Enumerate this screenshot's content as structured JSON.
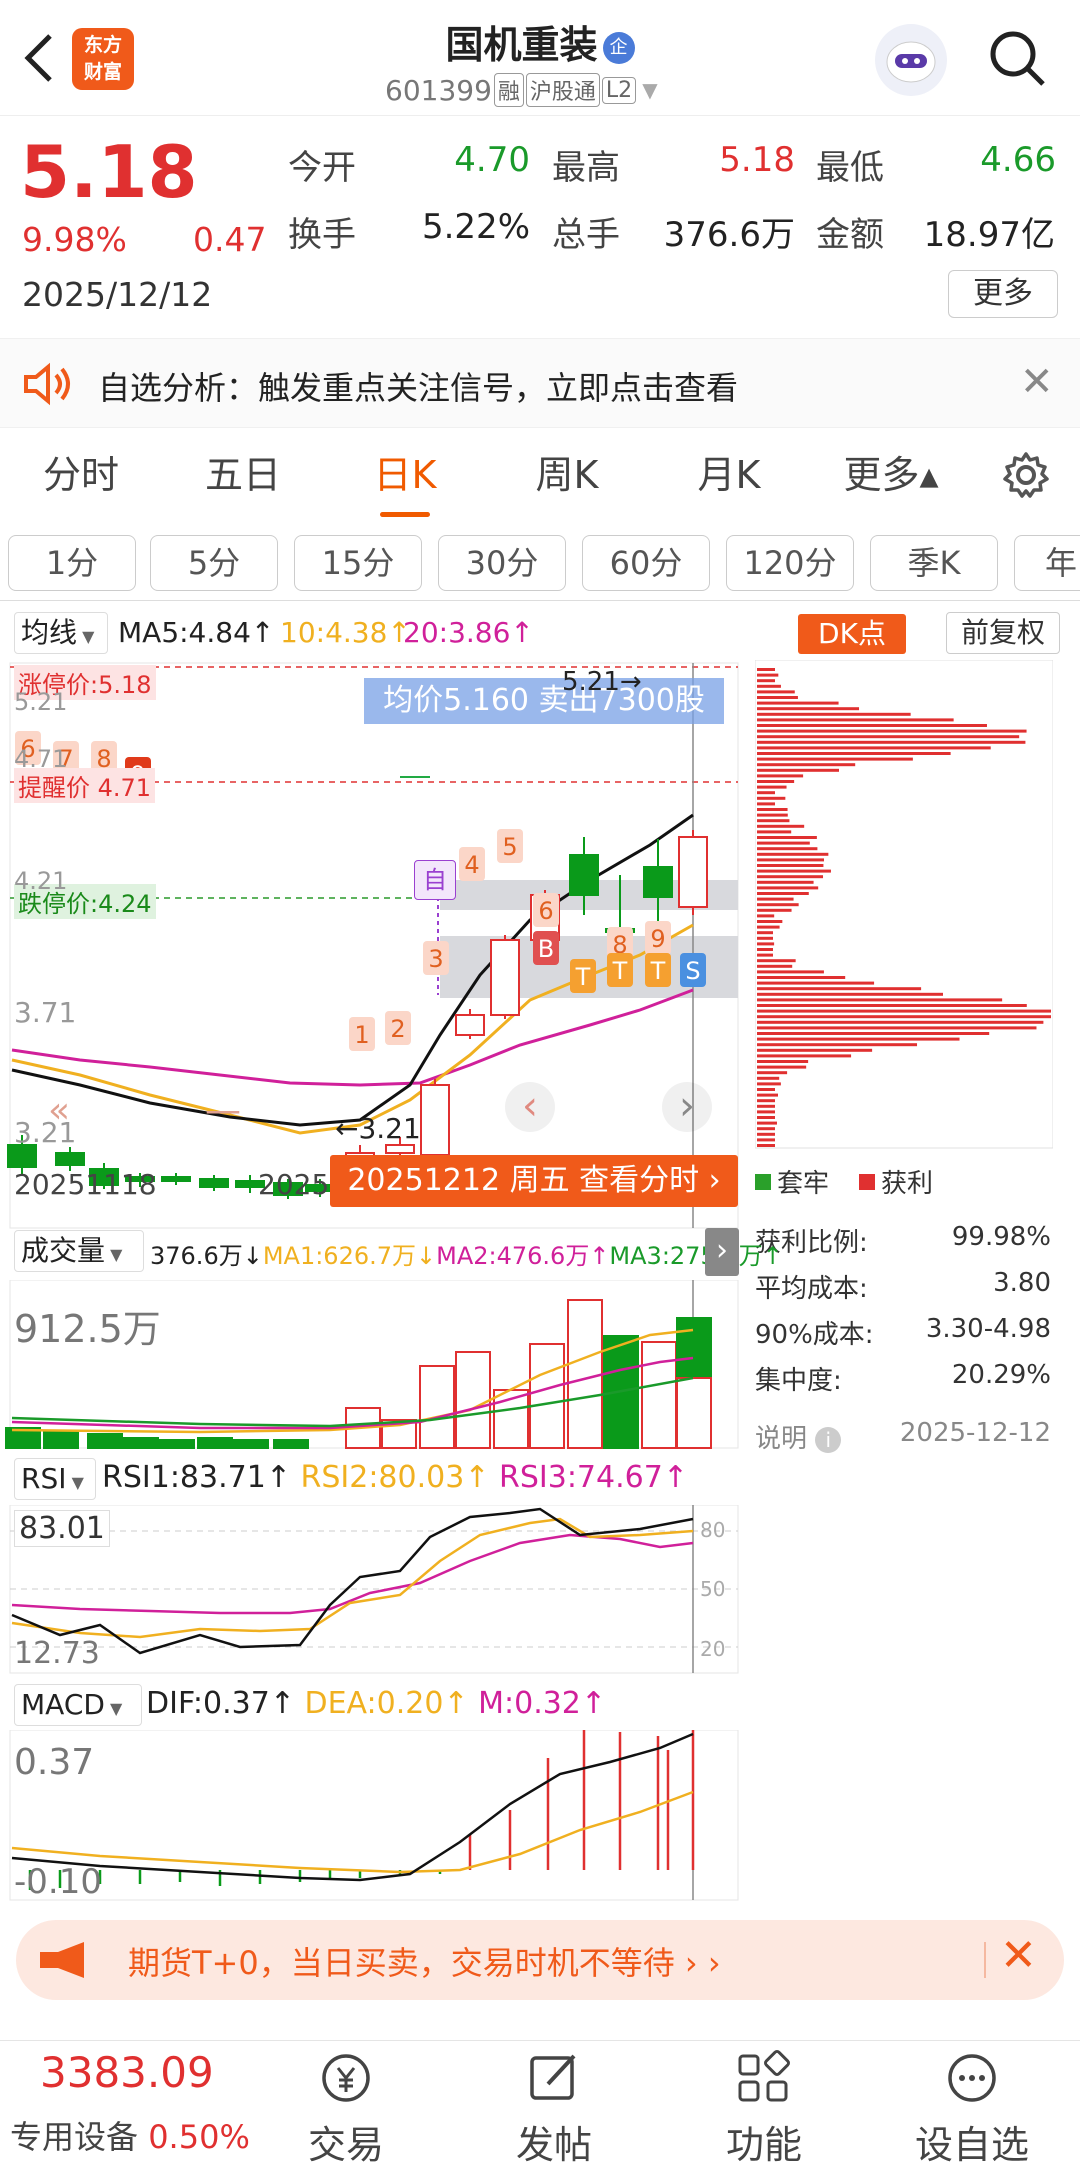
{
  "header": {
    "title": "国机重装",
    "code": "601399",
    "tags": [
      "融",
      "沪股通",
      "L2"
    ],
    "logo_text": [
      "东方",
      "财富"
    ],
    "qi_badge": "企"
  },
  "quote": {
    "price": "5.18",
    "change_pct": "9.98%",
    "change": "0.47",
    "date": "2025/12/12",
    "open_label": "今开",
    "open": "4.70",
    "high_label": "最高",
    "high": "5.18",
    "low_label": "最低",
    "low": "4.66",
    "turnover_label": "换手",
    "turnover": "5.22%",
    "volume_label": "总手",
    "volume": "376.6万",
    "amount_label": "金额",
    "amount": "18.97亿",
    "more": "更多"
  },
  "banner": {
    "text": "自选分析：触发重点关注信号，立即点击查看"
  },
  "tabs": [
    "分时",
    "五日",
    "日K",
    "周K",
    "月K",
    "更多▴"
  ],
  "periods": [
    "1分",
    "5分",
    "15分",
    "30分",
    "60分",
    "120分",
    "季K",
    "年"
  ],
  "kline": {
    "ma_selector": "均线",
    "ma5": "MA5:4.84↑",
    "ma10": "10:4.38↑",
    "ma20": "20:3.86↑",
    "dk_button": "DK点",
    "fq_button": "前复权",
    "zt_label": "涨停价:5.18",
    "tx_label": "提醒价 4.71",
    "dt_label": "跌停价:4.24",
    "y_labels": [
      "5.21",
      "4.71",
      "4.21",
      "3.71",
      "3.21"
    ],
    "low_marker": "3.21",
    "high_marker": "5.21",
    "tooltip": "均价5.160  卖出7300股",
    "date_left": "20251118",
    "date_mid": "2025",
    "date_popup": "20251212 周五 查看分时 ›",
    "marks": [
      "6",
      "7",
      "8",
      "9",
      "1",
      "2",
      "3",
      "4",
      "5",
      "6",
      "8",
      "9",
      "B",
      "T",
      "T",
      "T",
      "S"
    ],
    "self_mark": "自",
    "colors": {
      "up": "#e03030",
      "down": "#0a9a1a",
      "ma5": "#111111",
      "ma10": "#f0b020",
      "ma20": "#d0209a"
    }
  },
  "chip": {
    "legend_trap": "套牢",
    "legend_profit": "获利",
    "rows": [
      {
        "label": "获利比例:",
        "value": "99.98%"
      },
      {
        "label": "平均成本:",
        "value": "3.80"
      },
      {
        "label": "90%成本:",
        "value": "3.30-4.98"
      },
      {
        "label": "集中度:",
        "value": "20.29%"
      }
    ],
    "note_label": "说明",
    "note_date": "2025-12-12"
  },
  "volume": {
    "selector": "成交量",
    "v": "376.6万↓",
    "ma1": "MA1:626.7万↓",
    "ma2": "MA2:476.6万↑",
    "ma3": "MA3:275.0万↑",
    "max": "912.5万"
  },
  "rsi": {
    "selector": "RSI",
    "r1": "RSI1:83.71↑",
    "r2": "RSI2:80.03↑",
    "r3": "RSI3:74.67↑",
    "top": "83.01",
    "bottom": "12.73",
    "levels": [
      "80",
      "50",
      "20"
    ]
  },
  "macd": {
    "selector": "MACD",
    "dif": "DIF:0.37↑",
    "dea": "DEA:0.20↑",
    "m": "M:0.32↑",
    "top": "0.37",
    "bottom": "-0.10"
  },
  "ad": {
    "text": "期货T+0，当日买卖，交易时机不等待 › ›"
  },
  "bottom": {
    "index_value": "3383.09",
    "sector": "专用设备",
    "sector_pct": "0.50%",
    "nav": [
      "交易",
      "发帖",
      "功能",
      "设自选"
    ]
  }
}
